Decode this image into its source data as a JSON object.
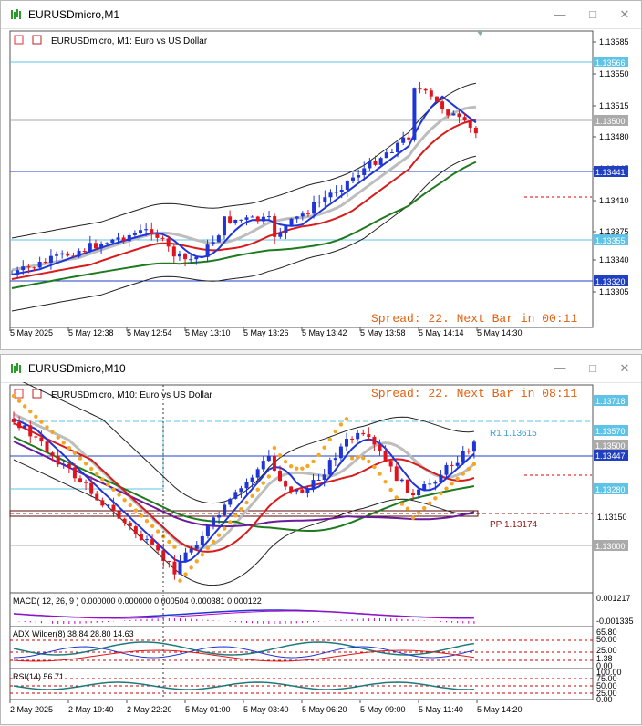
{
  "window1": {
    "title": "EURUSDmicro,M1",
    "chart_label": "EURUSDmicro, M1:  Euro vs US Dollar",
    "spread_text": "Spread: 22. Next Bar in 00:11",
    "price_axis": [
      "1.13585",
      "1.13550",
      "1.13515",
      "1.13480",
      "1.13445",
      "1.13410",
      "1.13375",
      "1.13340",
      "1.13305"
    ],
    "price_tags": [
      "1.13566",
      "1.13500",
      "1.13441",
      "1.13355",
      "1.13320"
    ],
    "time_axis": [
      "5 May 2025",
      "5 May 12:38",
      "5 May 12:54",
      "5 May 13:10",
      "5 May 13:26",
      "5 May 13:42",
      "5 May 13:58",
      "5 May 14:14",
      "5 May 14:30"
    ]
  },
  "window2": {
    "title": "EURUSDmicro,M10",
    "chart_label": "EURUSDmicro, M10:  Euro vs US Dollar",
    "spread_text": "Spread: 22. Next Bar in 08:11",
    "r1_label": "R1 1.13615",
    "pp_label": "PP 1.13174",
    "price_axis": [
      "1.13150"
    ],
    "price_tags": [
      "1.13718",
      "1.13570",
      "1.13500",
      "1.13447",
      "1.13280",
      "1.13000"
    ],
    "macd_label": "MACD( 12, 26, 9 ) 0.000000 0.000000 0.000504 0.000381 0.000122",
    "macd_axis": [
      "0.001217",
      "-0.001335"
    ],
    "adx_label": "ADX Wilder(8) 38.84 28.80 14.63",
    "adx_axis": [
      "65.80",
      "50.00",
      "25.00",
      "1.38",
      "0.00"
    ],
    "rsi_label": "RSI(14) 56.71",
    "rsi_axis": [
      "100.00",
      "75.00",
      "50.00",
      "25.00",
      "0.00"
    ],
    "time_axis": [
      "2 May 2025",
      "2 May 19:40",
      "2 May 22:20",
      "5 May 01:00",
      "5 May 03:40",
      "5 May 06:20",
      "5 May 09:00",
      "5 May 11:40",
      "5 May 14:20"
    ]
  },
  "colors": {
    "bull": "#1f35d6",
    "bear": "#e0141e",
    "ma_fast": "#1f35d6",
    "ma_mid": "#d81b1b",
    "ma_slow": "#1e7a1e",
    "ma_grey": "#bdbdbd",
    "sar": "#f5a623",
    "level": "#5ec3e6"
  },
  "icons": [
    "chart-app-icon",
    "minimize-icon",
    "maximize-icon",
    "close-icon"
  ]
}
